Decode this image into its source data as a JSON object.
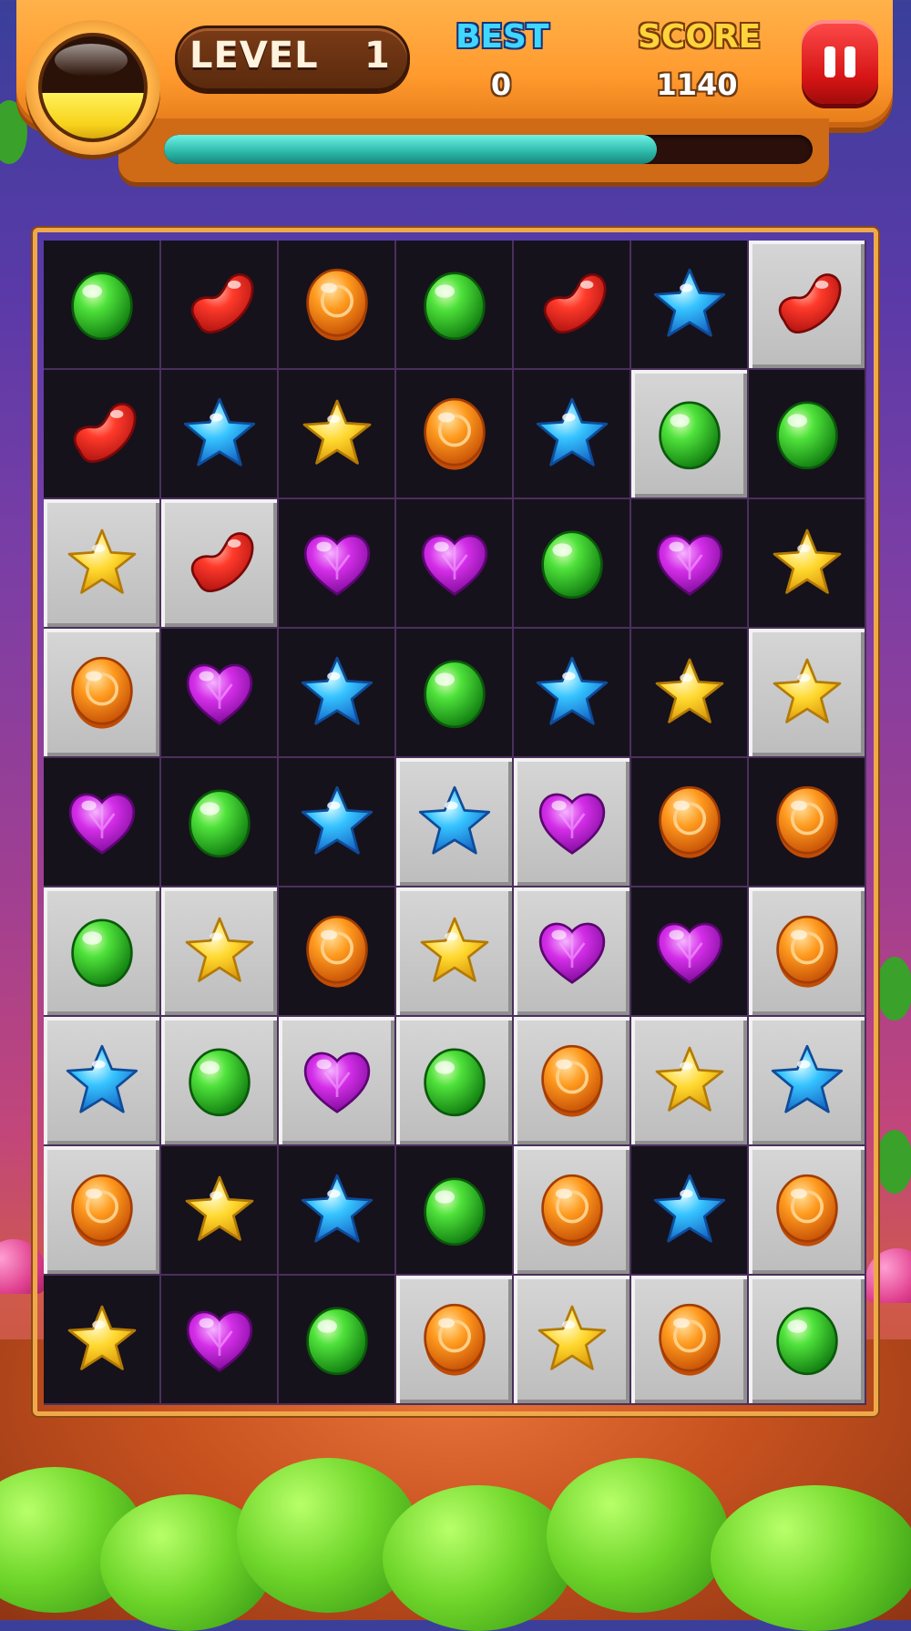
{
  "hud": {
    "level_label": "LEVEL",
    "level_value": "1",
    "best_label": "BEST",
    "best_value": "0",
    "score_label": "SCORE",
    "score_value": "1140",
    "progress_fraction": 0.76,
    "gauge_fill_fraction": 0.45
  },
  "colors": {
    "hud_orange": "#ff9a2e",
    "pause_red": "#d51414",
    "progress_teal": "#2ab7a8",
    "best_blue": "#3fd7ff",
    "score_gold": "#ffd33a"
  },
  "board": {
    "columns": 7,
    "rows": 9,
    "candies": [
      [
        "green-ball",
        "red-bean",
        "orange-coin",
        "green-ball",
        "red-bean",
        "blue-star",
        "red-bean"
      ],
      [
        "red-bean",
        "blue-star",
        "yellow-star",
        "orange-coin",
        "blue-star",
        "green-ball",
        "green-ball"
      ],
      [
        "yellow-star",
        "red-bean",
        "purple-heart",
        "purple-heart",
        "green-ball",
        "purple-heart",
        "yellow-star"
      ],
      [
        "orange-coin",
        "purple-heart",
        "blue-star",
        "green-ball",
        "blue-star",
        "yellow-star",
        "yellow-star"
      ],
      [
        "purple-heart",
        "green-ball",
        "blue-star",
        "blue-star",
        "purple-heart",
        "orange-coin",
        "orange-coin"
      ],
      [
        "green-ball",
        "yellow-star",
        "orange-coin",
        "yellow-star",
        "purple-heart",
        "purple-heart",
        "orange-coin"
      ],
      [
        "blue-star",
        "green-ball",
        "purple-heart",
        "green-ball",
        "orange-coin",
        "yellow-star",
        "blue-star"
      ],
      [
        "orange-coin",
        "yellow-star",
        "blue-star",
        "green-ball",
        "orange-coin",
        "blue-star",
        "orange-coin"
      ],
      [
        "yellow-star",
        "purple-heart",
        "green-ball",
        "orange-coin",
        "yellow-star",
        "orange-coin",
        "green-ball"
      ]
    ],
    "tiles": [
      [
        "dark",
        "dark",
        "dark",
        "dark",
        "dark",
        "dark",
        "light"
      ],
      [
        "dark",
        "dark",
        "dark",
        "dark",
        "dark",
        "light",
        "dark"
      ],
      [
        "light",
        "light",
        "dark",
        "dark",
        "dark",
        "dark",
        "dark"
      ],
      [
        "light",
        "dark",
        "dark",
        "dark",
        "dark",
        "dark",
        "light"
      ],
      [
        "dark",
        "dark",
        "dark",
        "light",
        "light",
        "dark",
        "dark"
      ],
      [
        "light",
        "light",
        "dark",
        "light",
        "light",
        "dark",
        "light"
      ],
      [
        "light",
        "light",
        "light",
        "light",
        "light",
        "light",
        "light"
      ],
      [
        "light",
        "dark",
        "dark",
        "dark",
        "light",
        "dark",
        "light"
      ],
      [
        "dark",
        "dark",
        "dark",
        "light",
        "light",
        "light",
        "light"
      ]
    ]
  }
}
